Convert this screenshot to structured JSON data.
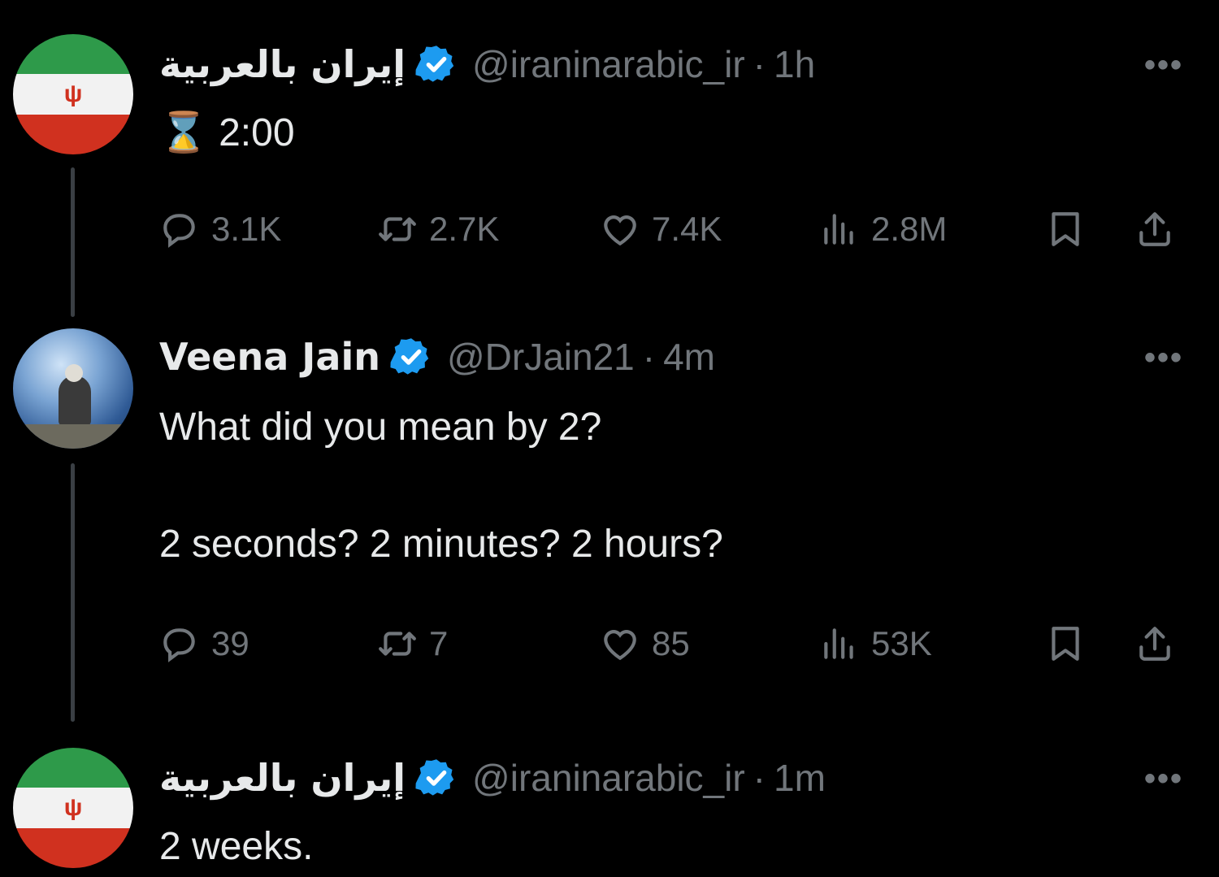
{
  "tweets": [
    {
      "name": "إيران بالعربية",
      "handle": "@iraninarabic_ir",
      "separator": "·",
      "time": "1h",
      "text": "⌛ 2:00",
      "more": "•••",
      "stats": {
        "replies": "3.1K",
        "reposts": "2.7K",
        "likes": "7.4K",
        "views": "2.8M"
      }
    },
    {
      "name": "Veena Jain",
      "handle": "@DrJain21",
      "separator": "·",
      "time": "4m",
      "text": "What did you mean by 2?\n\n2 seconds? 2 minutes? 2 hours?",
      "more": "•••",
      "stats": {
        "replies": "39",
        "reposts": "7",
        "likes": "85",
        "views": "53K"
      }
    },
    {
      "name": "إيران بالعربية",
      "handle": "@iraninarabic_ir",
      "separator": "·",
      "time": "1m",
      "text": "2 weeks.",
      "more": "•••"
    }
  ],
  "icons": [
    "reply-icon",
    "repost-icon",
    "like-icon",
    "views-icon",
    "bookmark-icon",
    "share-icon",
    "verified-badge-icon",
    "more-icon"
  ],
  "colors": {
    "background": "#000000",
    "text": "#e7e9ea",
    "muted": "#71767b",
    "verified": "#1d9bf0"
  }
}
